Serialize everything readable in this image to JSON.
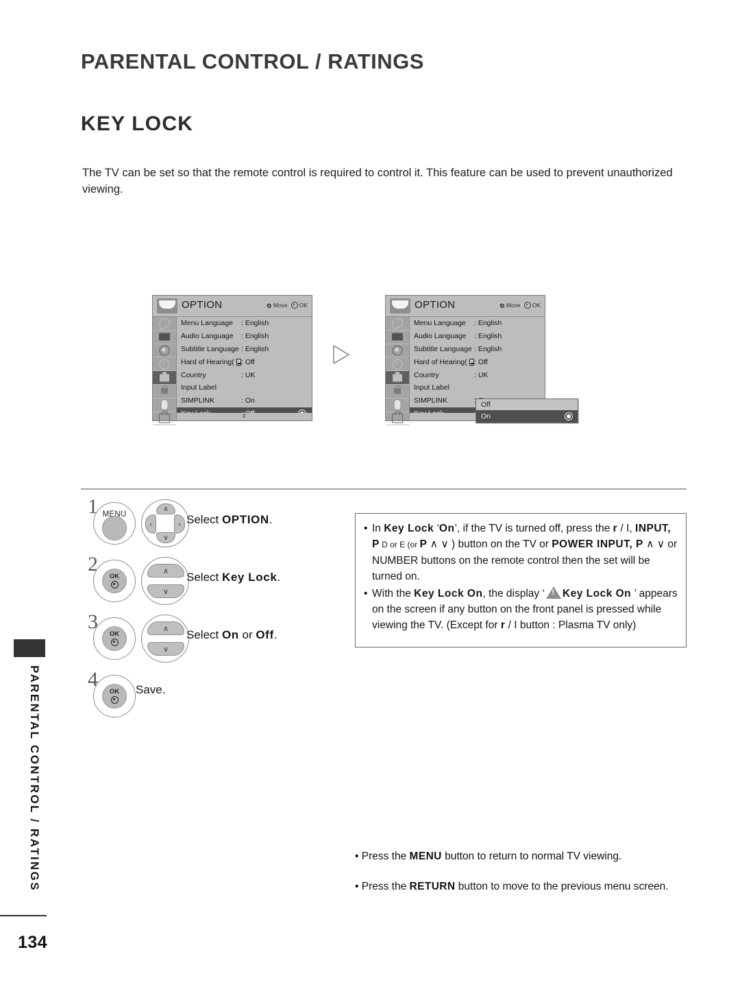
{
  "page": {
    "chapter_title": "PARENTAL CONTROL / RATINGS",
    "section_title": "KEY LOCK",
    "intro": "The TV can be set so that the remote control is required to control it. This feature can be used to prevent unauthorized viewing.",
    "page_number": "134",
    "side_tab_text": "PARENTAL CONTROL / RATINGS"
  },
  "osd": {
    "title": "OPTION",
    "hint_move": "Move",
    "hint_ok": "OK",
    "foot_mark": "E",
    "icons": [
      "satellite-icon",
      "picture-icon",
      "audio-icon",
      "time-icon",
      "option-icon",
      "lock-icon",
      "usb-icon",
      "return-icon"
    ],
    "rows": [
      {
        "label": "Menu Language",
        "value": ": English"
      },
      {
        "label": "Audio Language",
        "value": ": English"
      },
      {
        "label": "Subtitle Language",
        "value": ": English"
      },
      {
        "label": "Hard of Hearing(",
        "value": ": Off",
        "has_cc_icon": true
      },
      {
        "label": "Country",
        "value": ": UK"
      },
      {
        "label": "Input Label",
        "value": ""
      },
      {
        "label": "SIMPLINK",
        "value": ": On"
      },
      {
        "label": "Key Lock",
        "value": ": Off",
        "selected": true
      }
    ],
    "dropdown": {
      "options": [
        "Off",
        "On"
      ],
      "selected": "On"
    }
  },
  "steps": [
    {
      "num": "1",
      "button": "MENU",
      "control": "dpad",
      "text_plain": "Select ",
      "text_bold": "OPTION",
      "text_tail": "."
    },
    {
      "num": "2",
      "button": "OK",
      "control": "updown",
      "text_plain": "Select ",
      "text_bold": "Key Lock",
      "text_tail": "."
    },
    {
      "num": "3",
      "button": "OK",
      "control": "updown",
      "text_plain": "Select ",
      "text_bold": "On",
      "text_mid": " or ",
      "text_bold2": "Off",
      "text_tail": "."
    },
    {
      "num": "4",
      "button": "OK",
      "control": "none",
      "text_plain": "Save.",
      "text_bold": "",
      "text_tail": ""
    }
  ],
  "button_labels": {
    "menu": "MENU",
    "ok": "OK",
    "arrow_up": "∧",
    "arrow_down": "∨",
    "arrow_left": "‹",
    "arrow_right": "›"
  },
  "note_box": {
    "items": [
      {
        "p1": "In ",
        "b1": "Key Lock",
        "p2": " ‘",
        "b2": "On",
        "p3": "’, if the TV is turned off, press the ",
        "b3": "r",
        "p4": " / I, ",
        "b4": "INPUT, P",
        "p5": " D or E (or ",
        "b5": "P",
        "p6": " ∧ ∨ ) button on the TV or ",
        "b6": "POWER INPUT, P",
        "p7": " ∧ ∨ or NUMBER buttons on the remote control then the set will be turned on."
      },
      {
        "p1": "With the ",
        "b1": "Key Lock On",
        "p2": ", the display ‘",
        "icon": "warning-triangle-icon",
        "b2": "Key Lock On",
        "p3": " ’ appears on the screen if any button on the front panel is pressed while viewing the TV. (Except for ",
        "b3": "r",
        "p4": " / I button : Plasma TV only)"
      }
    ]
  },
  "bottom_notes": [
    {
      "pre": "• Press the ",
      "bold": "MENU",
      "post": " button to return to normal TV viewing."
    },
    {
      "pre": "• Press the ",
      "bold": "RETURN",
      "post": " button to move to the previous menu screen."
    }
  ]
}
